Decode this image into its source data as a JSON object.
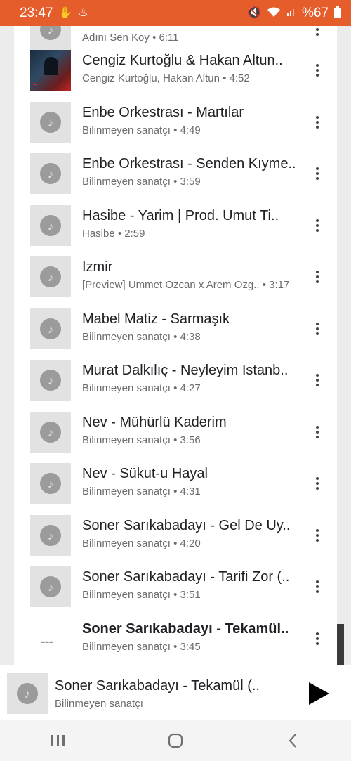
{
  "status_bar": {
    "time": "23:47",
    "left_icons": [
      "hand-gesture-icon",
      "notification-icon"
    ],
    "right_icons": [
      "mute-icon",
      "wifi-icon",
      "signal-icon"
    ],
    "battery": "%67"
  },
  "songs": [
    {
      "title": "",
      "subtitle": "Adını Sen Koy • 6:11",
      "art": "note"
    },
    {
      "title": "Cengiz Kurtoğlu & Hakan Altun..",
      "subtitle": "Cengiz Kurtoğlu, Hakan Altun • 4:52",
      "art": "cover"
    },
    {
      "title": "Enbe Orkestrası - Martılar",
      "subtitle": "Bilinmeyen sanatçı • 4:49",
      "art": "note"
    },
    {
      "title": "Enbe Orkestrası - Senden Kıyme..",
      "subtitle": "Bilinmeyen sanatçı • 3:59",
      "art": "note"
    },
    {
      "title": "Hasibe - Yarim | Prod. Umut Ti..",
      "subtitle": "Hasibe • 2:59",
      "art": "note"
    },
    {
      "title": "Izmir",
      "subtitle": "[Preview] Ummet Ozcan x Arem Ozg..   • 3:17",
      "art": "note"
    },
    {
      "title": "Mabel Matiz - Sarmaşık",
      "subtitle": "Bilinmeyen sanatçı • 4:38",
      "art": "note"
    },
    {
      "title": "Murat Dalkılıç - Neyleyim İstanb..",
      "subtitle": "Bilinmeyen sanatçı • 4:27",
      "art": "note"
    },
    {
      "title": "Nev - Mühürlü Kaderim",
      "subtitle": "Bilinmeyen sanatçı • 3:56",
      "art": "note"
    },
    {
      "title": "Nev - Sükut-u Hayal",
      "subtitle": "Bilinmeyen sanatçı • 4:31",
      "art": "note"
    },
    {
      "title": "Soner Sarıkabadayı - Gel De Uy..",
      "subtitle": "Bilinmeyen sanatçı • 4:20",
      "art": "note"
    },
    {
      "title": "Soner Sarıkabadayı - Tarifi Zor (..",
      "subtitle": "Bilinmeyen sanatçı • 3:51",
      "art": "note"
    },
    {
      "title": "Soner Sarıkabadayı - Tekamül..",
      "subtitle": "Bilinmeyen sanatçı • 3:45",
      "art": "playing",
      "playing_marker": "---"
    }
  ],
  "now_playing": {
    "title": "Soner Sarıkabadayı - Tekamül (..",
    "artist": "Bilinmeyen sanatçı",
    "play_icon": "play-icon"
  },
  "nav_bar": {
    "recents_icon": "recents-icon",
    "home_icon": "home-icon",
    "back_icon": "back-icon"
  },
  "colors": {
    "status_bar": "#e55d2a",
    "panel": "#ffffff",
    "background": "#ececec"
  }
}
